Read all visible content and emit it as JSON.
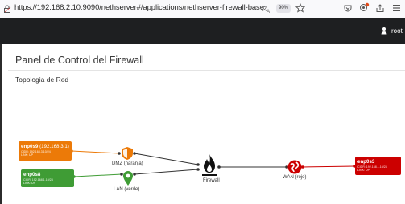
{
  "browser": {
    "url": "https://192.168.2.10:9090/nethserver#/applications/nethserver-firewall-base",
    "zoom": "90%"
  },
  "header": {
    "user": "root"
  },
  "page": {
    "title": "Panel de Control del Firewall",
    "section": "Topologia de Red"
  },
  "interfaces": {
    "orange": {
      "name": "enp0s9",
      "ip_text": "(192.168.3.1)",
      "line1": "CIDR: 192.168.3.10/24",
      "line2": "LINK: UP",
      "color": "#ec7a08"
    },
    "green": {
      "name": "enp0s8",
      "line1": "CIDR: 192.168.1.10/24",
      "line2": "LINK: UP",
      "color": "#3f9c35"
    },
    "red": {
      "name": "enp0s3",
      "line1": "CIDR: 192.168.1.10/24",
      "line2": "LINK: UP",
      "color": "#cc0000"
    }
  },
  "zones": {
    "dmz": {
      "label": "DMZ (naranja)",
      "icon": "shield-icon",
      "color": "#ec7a08"
    },
    "lan": {
      "label": "LAN (verde)",
      "icon": "map-pin-icon",
      "color": "#3f9c35"
    },
    "wan": {
      "label": "WAN (rojo)",
      "icon": "globe-icon",
      "color": "#cc0000"
    },
    "firewall": {
      "label": "Firewall",
      "icon": "fire-icon"
    }
  }
}
